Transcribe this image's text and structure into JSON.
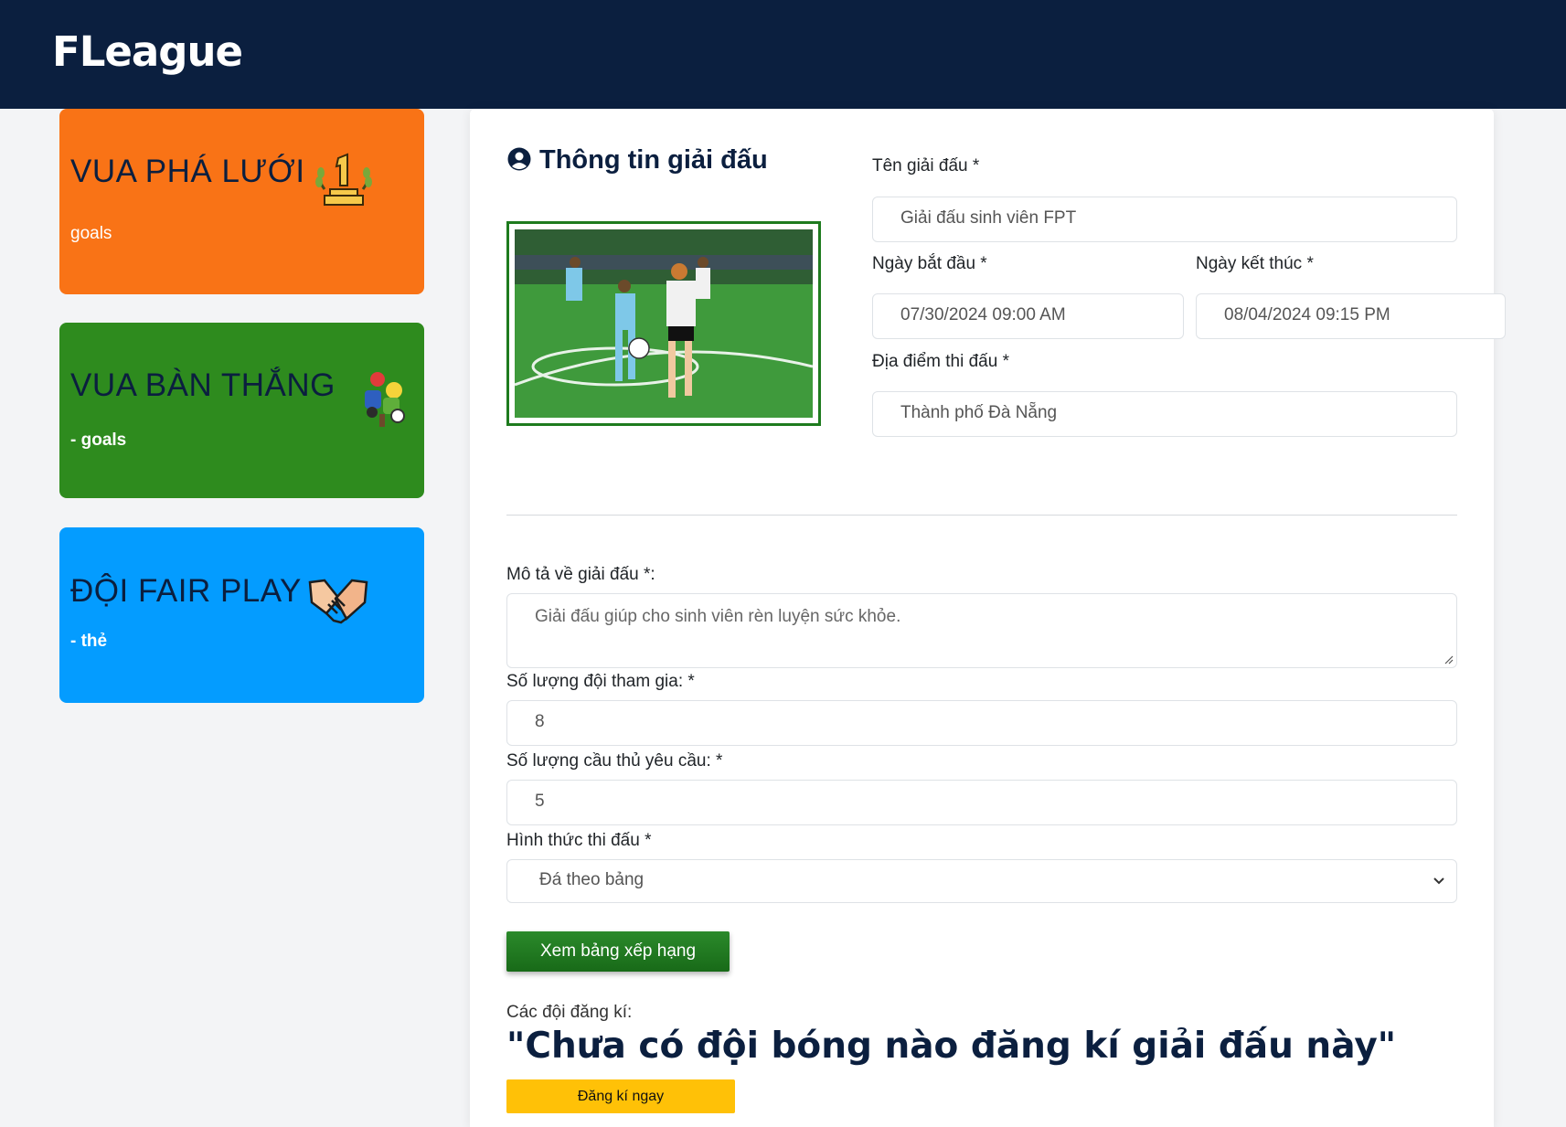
{
  "header": {
    "brand": "FLeague"
  },
  "awards": [
    {
      "title": "VUA PHÁ LƯỚI",
      "sub": "goals",
      "icon": "trophy-icon",
      "color": "#f97316"
    },
    {
      "title": "VUA BÀN THẮNG",
      "sub": "- goals",
      "icon": "soccer-players-icon",
      "color": "#2e8b1e"
    },
    {
      "title": "ĐỘI FAIR PLAY",
      "sub": "- thẻ",
      "icon": "handshake-icon",
      "color": "#049cff"
    }
  ],
  "form": {
    "section_title": "Thông tin giải đấu",
    "name": {
      "label": "Tên giải đấu *",
      "value": "Giải đấu sinh viên FPT"
    },
    "start": {
      "label": "Ngày bắt đầu *",
      "value": "07/30/2024 09:00  AM"
    },
    "end": {
      "label": "Ngày kết thúc *",
      "value": "08/04/2024 09:15  PM"
    },
    "location": {
      "label": "Địa điểm thi đấu *",
      "value": "Thành phố Đà Nẵng"
    },
    "description": {
      "label": "Mô tả về giải đấu *:",
      "value": "Giải đấu giúp cho sinh viên rèn luyện sức khỏe."
    },
    "teams_count": {
      "label": "Số lượng đội tham gia: *",
      "value": "8"
    },
    "players_count": {
      "label": "Số lượng cầu thủ yêu cầu: *",
      "value": "5"
    },
    "format": {
      "label": "Hình thức thi đấu *",
      "value": "Đá theo bảng"
    },
    "standings_button": "Xem bảng xếp hạng",
    "registered_label": "Các đội đăng kí:",
    "empty_message": "\"Chưa có đội bóng nào đăng kí giải đấu này\"",
    "register_button": "Đăng kí ngay"
  }
}
